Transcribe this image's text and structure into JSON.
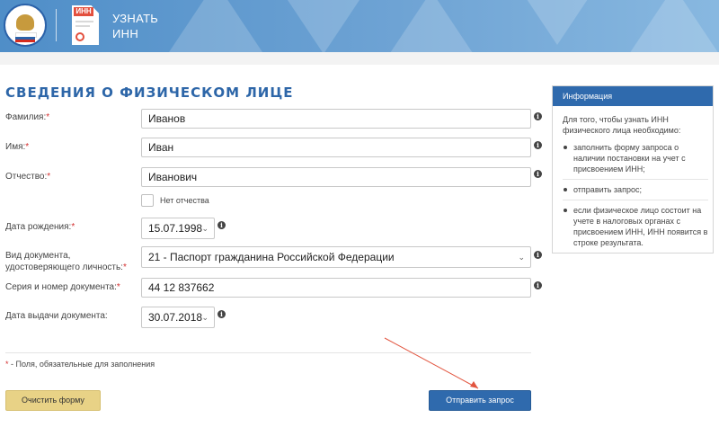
{
  "header": {
    "title_line1": "УЗНАТЬ",
    "title_line2": "ИНН",
    "doc_badge": "ИНН"
  },
  "form": {
    "section_title": "СВЕДЕНИЯ О ФИЗИЧЕСКОМ ЛИЦЕ",
    "fields": {
      "surname": {
        "label": "Фамилия:",
        "value": "Иванов"
      },
      "name": {
        "label": "Имя:",
        "value": "Иван"
      },
      "patronymic": {
        "label": "Отчество:",
        "value": "Иванович"
      },
      "no_patronymic": {
        "label": "Нет отчества",
        "checked": false
      },
      "birth_date": {
        "label": "Дата рождения:",
        "value": "15.07.1998"
      },
      "doc_type": {
        "label_line1": "Вид документа,",
        "label_line2": "удостоверяющего личность:",
        "value": "21 - Паспорт гражданина Российской Федерации"
      },
      "doc_number": {
        "label": "Серия и номер документа:",
        "value": "44 12 837662"
      },
      "doc_date": {
        "label": "Дата выдачи документа:",
        "value": "30.07.2018"
      }
    },
    "required_mark": "*",
    "required_note": "- Поля, обязательные для заполнения",
    "clear_button": "Очистить форму",
    "submit_button": "Отправить запрос"
  },
  "info_panel": {
    "title": "Информация",
    "intro": "Для того, чтобы узнать ИНН физического лица необходимо:",
    "items": [
      "заполнить форму запроса о наличии постановки на учет с присвоением ИНН;",
      "отправить запрос;",
      "если физическое лицо состоит на учете в налоговых органах с присвоением ИНН, ИНН появится в строке результата."
    ]
  },
  "colors": {
    "accent": "#2f6aad",
    "title": "#2d66a8",
    "required": "#d32f2f",
    "clear_button_bg": "#e8d286",
    "arrow": "#e2553f"
  },
  "icons": [
    "logo-emblem-icon",
    "inn-document-icon",
    "info-icon",
    "chevron-down-icon",
    "annotation-arrow"
  ]
}
